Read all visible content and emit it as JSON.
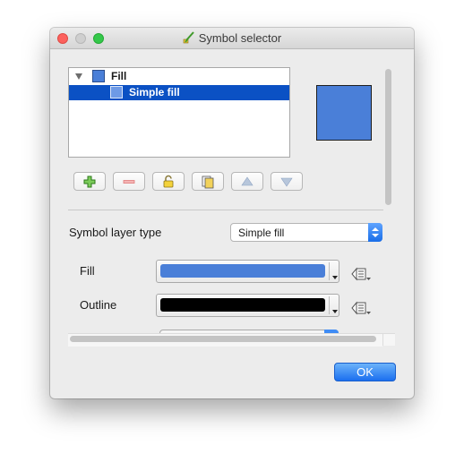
{
  "window": {
    "title": "Symbol selector",
    "title_icon": "symbology-brush-icon"
  },
  "symbol_tree": {
    "items": [
      {
        "label": "Fill",
        "icon": "fill-swatch-icon",
        "expanded": true,
        "level": 0,
        "selected": false
      },
      {
        "label": "Simple fill",
        "icon": "fill-swatch-icon",
        "level": 1,
        "selected": true
      }
    ]
  },
  "preview": {
    "color": "#4a7fd8",
    "outline": "#1e1e1e"
  },
  "layer_toolbar": {
    "buttons": [
      {
        "name": "add-layer-button",
        "icon": "plus-icon"
      },
      {
        "name": "remove-layer-button",
        "icon": "minus-icon",
        "enabled": false
      },
      {
        "name": "lock-layer-button",
        "icon": "lock-icon"
      },
      {
        "name": "duplicate-layer-button",
        "icon": "duplicate-icon"
      },
      {
        "name": "move-up-button",
        "icon": "triangle-up-icon",
        "enabled": false
      },
      {
        "name": "move-down-button",
        "icon": "triangle-down-icon",
        "enabled": false
      }
    ]
  },
  "properties": {
    "symbol_layer_type_label": "Symbol layer type",
    "symbol_layer_type_value": "Simple fill",
    "fill_label": "Fill",
    "fill_color": "#4a7fd8",
    "outline_label": "Outline",
    "outline_color": "#000000"
  },
  "buttons": {
    "ok": "OK"
  },
  "colors": {
    "accent": "#1b6fef",
    "selection": "#0b51c4"
  }
}
